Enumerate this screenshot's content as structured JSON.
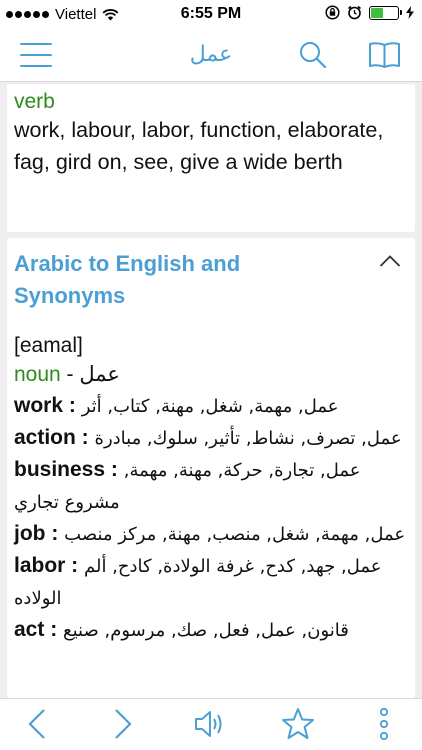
{
  "status": {
    "carrier": "Viettel",
    "time": "6:55 PM"
  },
  "nav": {
    "title": "عمل",
    "icons": [
      "menu-icon",
      "search-icon",
      "book-icon"
    ]
  },
  "card1": {
    "pos": "verb",
    "definition": "work, labour, labor, function, elaborate, fag, gird on, see, give a wide berth"
  },
  "card2": {
    "title": "Arabic to English and Synonyms",
    "pronunciation": "[eamal]",
    "noun_label": "noun",
    "noun_word": " - عمل",
    "entries": [
      {
        "en": "work",
        "ar": "عمل, مهمة, شغل, مهنة, كتاب, أثر"
      },
      {
        "en": "action",
        "ar": "عمل, تصرف, نشاط, تأثير, سلوك, مبادرة"
      },
      {
        "en": "business",
        "ar": "عمل, تجارة, حركة, مهنة, مهمة, مشروع تجاري"
      },
      {
        "en": "job",
        "ar": "عمل, مهمة, شغل, منصب, مهنة, مركز منصب"
      },
      {
        "en": "labor",
        "ar": "عمل, جهد, كدح, غرفة الولادة, كادح, ألم الولاده"
      },
      {
        "en": "act",
        "ar": "قانون, عمل, فعل, صك, مرسوم, صنيع"
      }
    ]
  },
  "colors": {
    "accent": "#4a9fd5",
    "pos_green": "#2e8b1e"
  },
  "bottom": {
    "icons": [
      "back-icon",
      "forward-icon",
      "speaker-icon",
      "star-icon",
      "more-icon"
    ]
  }
}
